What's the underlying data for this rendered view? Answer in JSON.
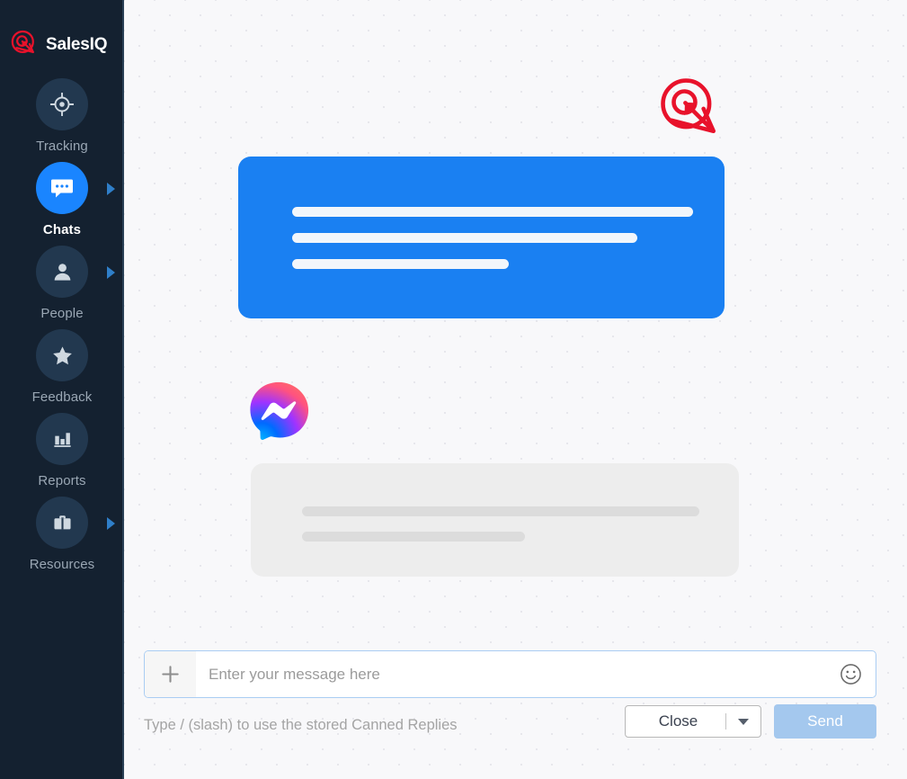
{
  "brand": {
    "name": "SalesIQ",
    "logo_icon": "salesiq-logo-icon",
    "logo_color": "#e8122b"
  },
  "sidebar": {
    "background_color": "#142130",
    "active_color": "#1a85ff",
    "items": [
      {
        "label": "Tracking",
        "icon": "target-crosshair-icon",
        "active": false,
        "has_arrow": false
      },
      {
        "label": "Chats",
        "icon": "chat-bubble-icon",
        "active": true,
        "has_arrow": true
      },
      {
        "label": "People",
        "icon": "person-icon",
        "active": false,
        "has_arrow": true
      },
      {
        "label": "Feedback",
        "icon": "star-icon",
        "active": false,
        "has_arrow": false
      },
      {
        "label": "Reports",
        "icon": "bar-chart-icon",
        "active": false,
        "has_arrow": false
      },
      {
        "label": "Resources",
        "icon": "briefcase-icon",
        "active": false,
        "has_arrow": true
      }
    ]
  },
  "conversation": {
    "watermark_icon": "salesiq-logo-watermark-icon",
    "outgoing_bubble": {
      "color": "#1a80f2",
      "placeholder_line_widths": [
        "100%",
        "86%",
        "54%"
      ]
    },
    "channel_avatar": {
      "name": "facebook-messenger-icon",
      "gradient": [
        "#00b2ff",
        "#006aff",
        "#a033ff",
        "#ff5280",
        "#ff7061"
      ]
    },
    "incoming_bubble": {
      "color": "#ededed",
      "placeholder_line_widths": [
        "98%",
        "55%"
      ]
    }
  },
  "composer": {
    "attach_icon": "plus-icon",
    "emoji_icon": "smiley-face-icon",
    "message_input_value": "",
    "message_input_placeholder": "Enter your message here",
    "hint_text": "Type / (slash) to use the stored Canned Replies",
    "close_label": "Close",
    "close_caret_icon": "chevron-down-icon",
    "send_label": "Send",
    "send_button_color": "#a4c8ee"
  }
}
